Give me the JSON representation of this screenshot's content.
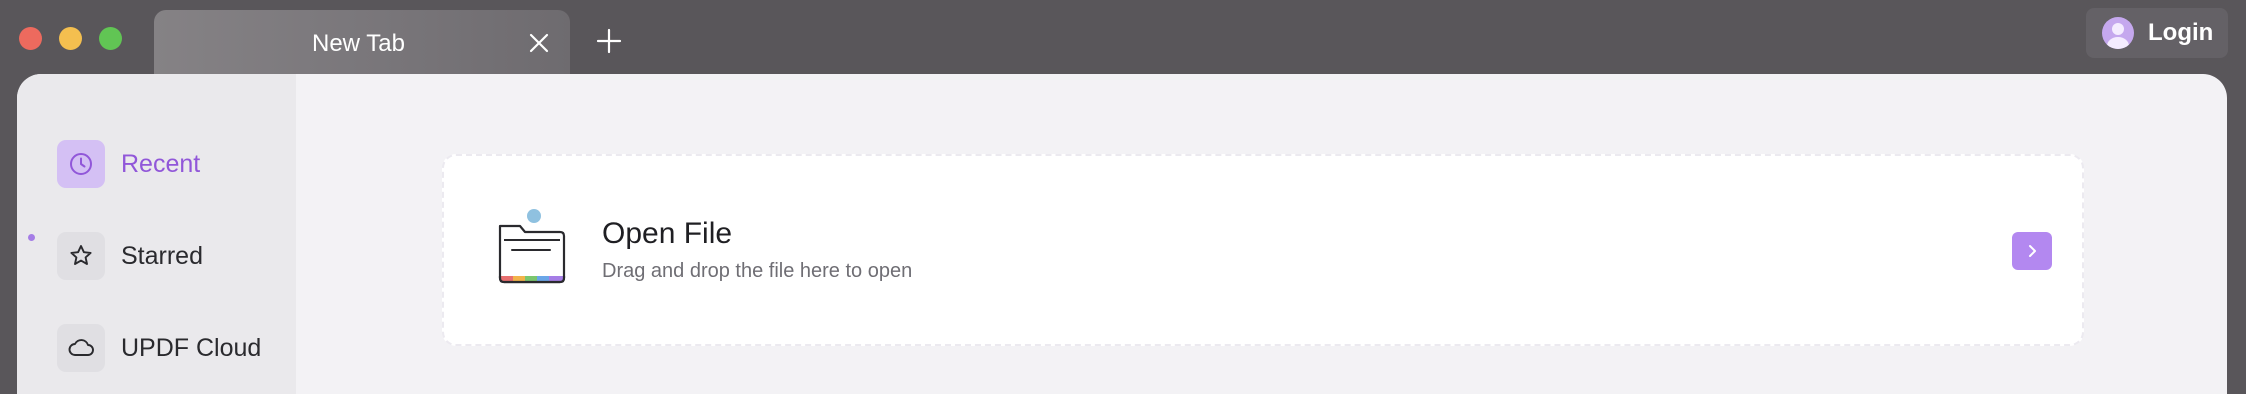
{
  "window_controls": {
    "close_color": "#ed6a5e",
    "minimize_color": "#f4bf4f",
    "maximize_color": "#61c554"
  },
  "tabs": [
    {
      "title": "New Tab"
    }
  ],
  "account": {
    "login_label": "Login"
  },
  "sidebar": {
    "items": [
      {
        "label": "Recent",
        "icon": "clock-icon",
        "active": true
      },
      {
        "label": "Starred",
        "icon": "star-icon",
        "active": false
      },
      {
        "label": "UPDF Cloud",
        "icon": "cloud-icon",
        "active": false
      }
    ]
  },
  "open_file": {
    "title": "Open File",
    "subtitle": "Drag and drop the file here to open",
    "icon": "folder-icon",
    "action_icon": "chevron-right-icon"
  },
  "colors": {
    "accent": "#9157d9",
    "accent_light": "#d4c0f4",
    "button": "#b388f0"
  }
}
